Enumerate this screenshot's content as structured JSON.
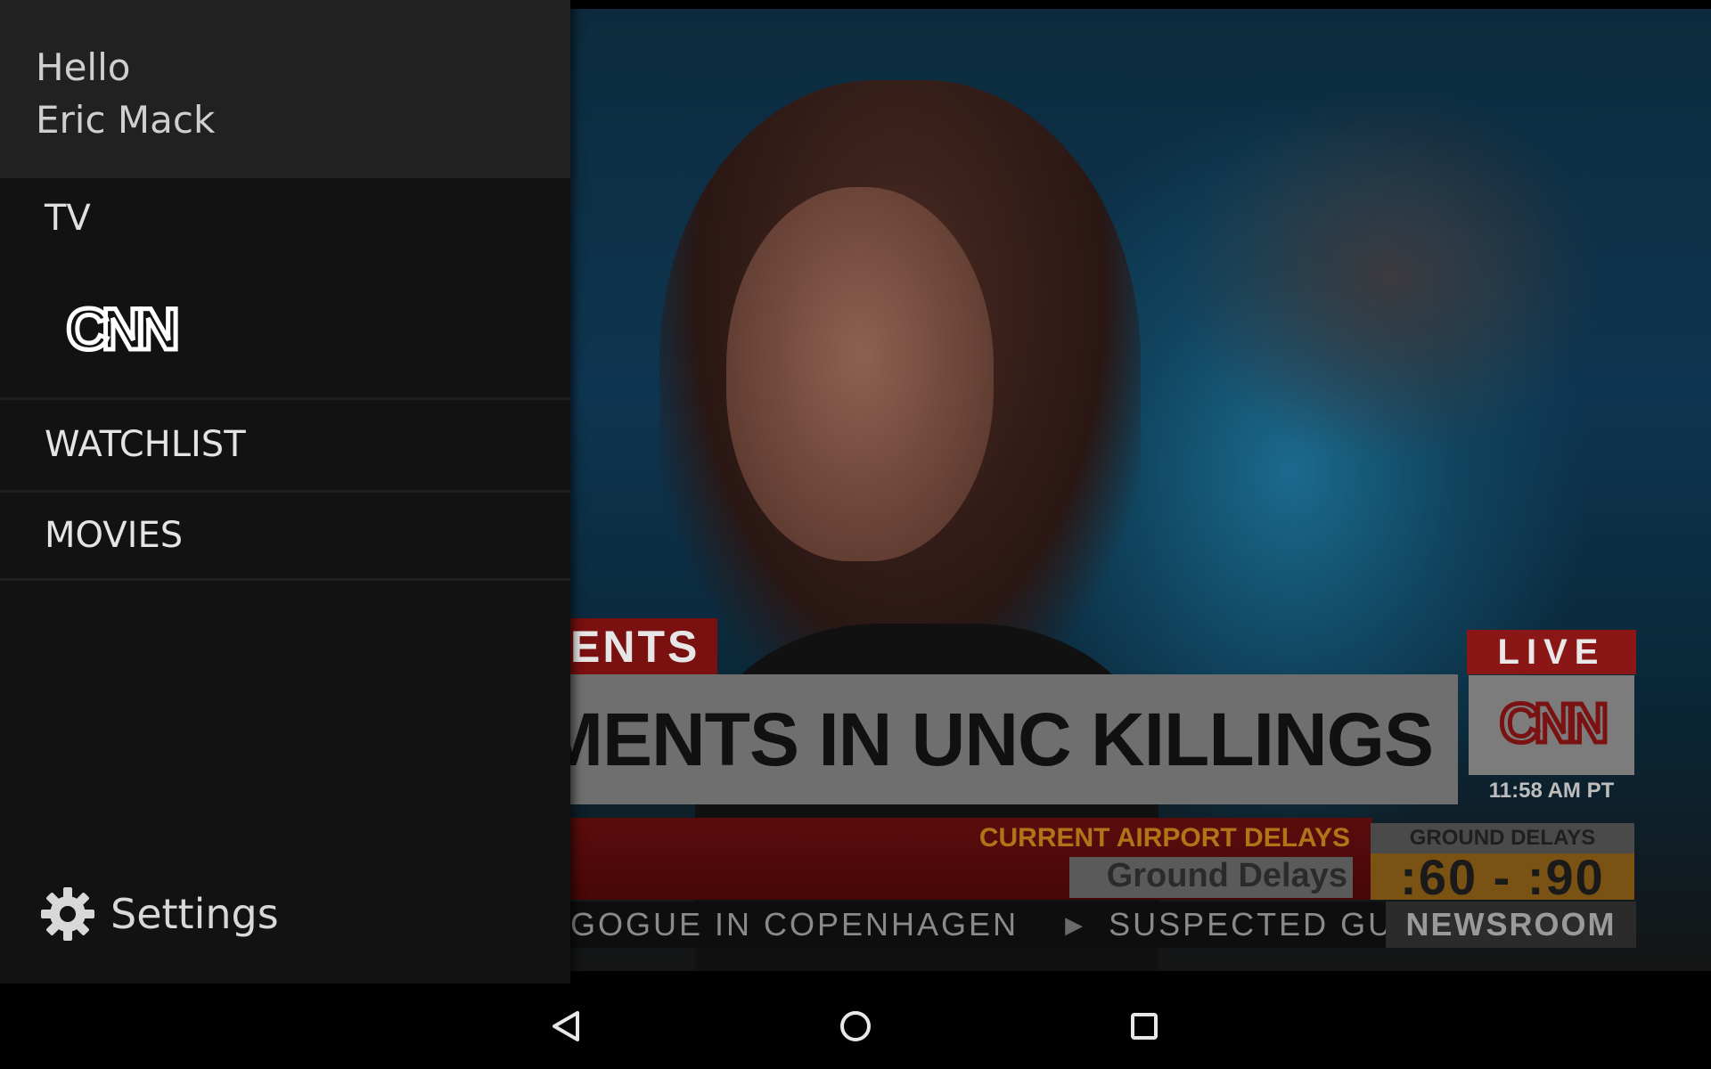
{
  "drawer": {
    "greeting_line1": "Hello",
    "greeting_line2": "Eric Mack",
    "section_title": "TV",
    "channel_logo": "CNN",
    "nav_items": [
      {
        "label": "WATCHLIST"
      },
      {
        "label": "MOVIES"
      }
    ],
    "settings_label": "Settings",
    "settings_icon": "gear-icon"
  },
  "video": {
    "section_tag": "ENTS",
    "headline": "CTMENTS IN UNC KILLINGS",
    "live_label": "LIVE",
    "logo_text": "CNN",
    "time": "11:58 AM PT",
    "delay_title": "CURRENT AIRPORT DELAYS",
    "delay_subtitle": "Ground Delays",
    "delay_box_label": "GROUND DELAYS",
    "delay_box_value": ":60 - :90",
    "ticker_part1": "GOGUE IN COPENHAGEN",
    "ticker_part2": "SUSPECTED GU",
    "show_name": "NEWSROOM"
  },
  "system_nav": {
    "back_icon": "back-triangle-icon",
    "home_icon": "home-circle-icon",
    "recent_icon": "recent-apps-square-icon"
  },
  "colors": {
    "drawer_bg": "#121212",
    "drawer_header_bg": "#212121",
    "cnn_red": "#8a1616"
  }
}
